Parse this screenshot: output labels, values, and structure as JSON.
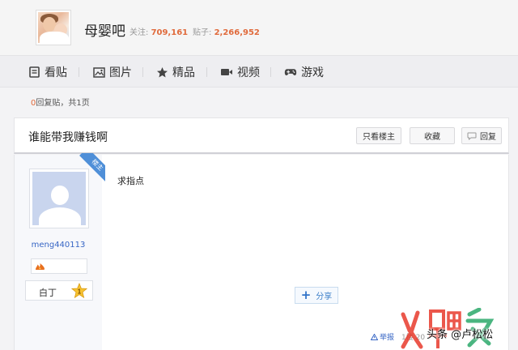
{
  "header": {
    "forum_name": "母婴吧",
    "follow_label": "关注:",
    "follow_count": "709,161",
    "posts_label": "贴子:",
    "posts_count": "2,266,952"
  },
  "nav": {
    "items": [
      {
        "label": "看贴",
        "icon": "document-icon"
      },
      {
        "label": "图片",
        "icon": "image-icon"
      },
      {
        "label": "精品",
        "icon": "star-icon"
      },
      {
        "label": "视频",
        "icon": "video-icon"
      },
      {
        "label": "游戏",
        "icon": "gamepad-icon"
      }
    ]
  },
  "reply_info": {
    "count": "0",
    "text": "回复贴，共1页"
  },
  "post": {
    "title": "谁能带我赚钱啊",
    "buttons": {
      "only_owner": "只看楼主",
      "collect": "收藏",
      "reply": "回复"
    },
    "author": {
      "badge": "楼主",
      "username": "meng440113",
      "level_name": "白丁",
      "level_num": "1"
    },
    "content": "求指点",
    "share_label": "分享",
    "report_label": "举报",
    "floor_text": "1楼 20"
  },
  "watermark": {
    "text": "头条 @卢松松"
  },
  "colors": {
    "accent_orange": "#e06a3b",
    "link_blue": "#3766c5",
    "ribbon_blue": "#4f8fd8",
    "watermark_red": "#e8392b",
    "watermark_green": "#2aa86a"
  }
}
